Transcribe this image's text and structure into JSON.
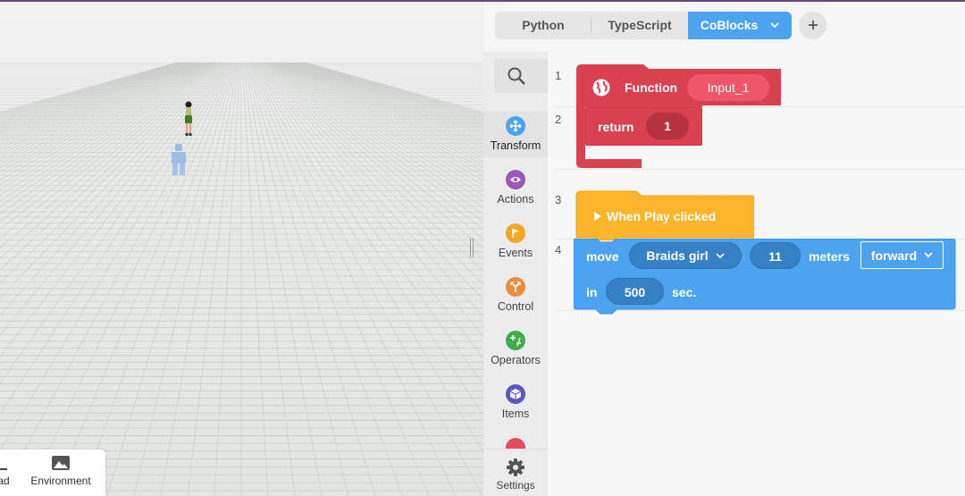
{
  "header": {
    "tabs": [
      {
        "label": "Python"
      },
      {
        "label": "TypeScript"
      },
      {
        "label": "CoBlocks"
      }
    ],
    "active_tab": "CoBlocks"
  },
  "viewport": {
    "tabs": [
      {
        "label": "ad"
      },
      {
        "label": "Environment"
      }
    ]
  },
  "sidebar": {
    "categories": [
      {
        "label": "Transform",
        "color": "#4ca3f0",
        "icon": "move-arrows-icon"
      },
      {
        "label": "Actions",
        "color": "#9b59b6",
        "icon": "eye-icon"
      },
      {
        "label": "Events",
        "color": "#f5a623",
        "icon": "flag-icon"
      },
      {
        "label": "Control",
        "color": "#f08a3c",
        "icon": "branch-icon"
      },
      {
        "label": "Operators",
        "color": "#3cae4b",
        "icon": "plus-minus-icon"
      },
      {
        "label": "Items",
        "color": "#5a55c8",
        "icon": "cube-icon"
      }
    ],
    "settings_label": "Settings"
  },
  "code": {
    "line_numbers": [
      "1",
      "2",
      "3",
      "4"
    ],
    "function_block": {
      "keyword": "Function",
      "name": "Input_1",
      "return_keyword": "return",
      "return_value": "1",
      "color": "#d94050"
    },
    "event_block": {
      "label": "When Play clicked",
      "color": "#fbb52b"
    },
    "move_block": {
      "keyword": "move",
      "target": "Braids girl",
      "distance": "11",
      "unit": "meters",
      "direction": "forward",
      "in_keyword": "in",
      "duration": "500",
      "duration_unit": "sec.",
      "color": "#4ca3f0"
    }
  }
}
